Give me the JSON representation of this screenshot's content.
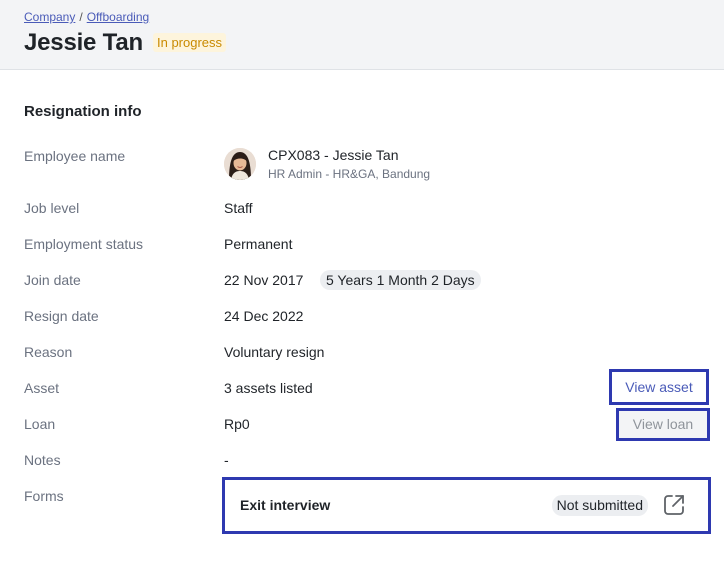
{
  "breadcrumb": {
    "company": "Company",
    "separator": "/",
    "offboarding": "Offboarding"
  },
  "header": {
    "title": "Jessie Tan",
    "status": "In progress"
  },
  "section": {
    "title": "Resignation info"
  },
  "fields": {
    "employee_name": {
      "label": "Employee name",
      "name": "CPX083 - Jessie Tan",
      "sub": "HR Admin - HR&GA, Bandung"
    },
    "job_level": {
      "label": "Job level",
      "value": "Staff"
    },
    "employment_status": {
      "label": "Employment status",
      "value": "Permanent"
    },
    "join_date": {
      "label": "Join date",
      "value": "22 Nov 2017",
      "duration": "5 Years 1 Month 2 Days"
    },
    "resign_date": {
      "label": "Resign date",
      "value": "24 Dec 2022"
    },
    "reason": {
      "label": "Reason",
      "value": "Voluntary resign"
    },
    "asset": {
      "label": "Asset",
      "value": "3 assets listed",
      "action": "View asset"
    },
    "loan": {
      "label": "Loan",
      "value": "Rp0",
      "action": "View loan"
    },
    "notes": {
      "label": "Notes",
      "value": "-"
    },
    "forms": {
      "label": "Forms",
      "form_name": "Exit interview",
      "form_status": "Not submitted"
    }
  },
  "icons": {
    "avatar": "avatar-photo",
    "open_form": "external-link-icon"
  },
  "colors": {
    "accent": "#2e39b0",
    "link": "#4a5bb8",
    "status_text": "#c98a00",
    "status_bg": "#fdf4dc"
  }
}
